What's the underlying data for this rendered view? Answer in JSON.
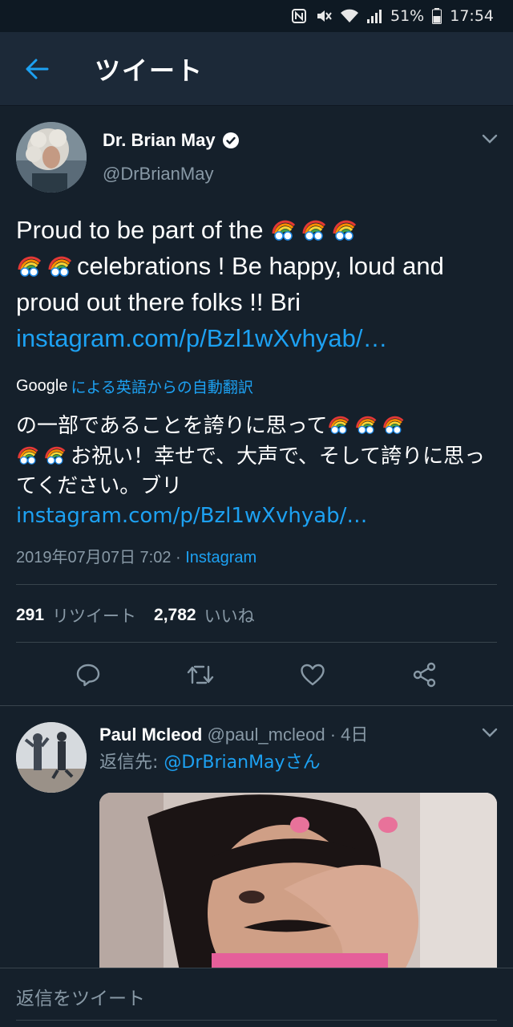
{
  "status_bar": {
    "battery": "51%",
    "time": "17:54",
    "icons": [
      "nfc-icon",
      "mute-icon",
      "wifi-icon",
      "signal-icon",
      "battery-icon"
    ]
  },
  "header": {
    "back_icon": "arrow-left-icon",
    "title": "ツイート"
  },
  "tweet": {
    "author_name": "Dr. Brian May",
    "verified_icon": "verified-badge-icon",
    "handle": "@DrBrianMay",
    "text_part1": "Proud to be part of the ",
    "text_part2": "celebrations ! Be happy, loud and proud out there folks !! Bri ",
    "text_link": "instagram.com/p/Bzl1wXvhyab/…",
    "translation_brand": "Google",
    "translation_label": "による英語からの自動翻訳",
    "translated_part1": "の一部であることを誇りに思って",
    "translated_part2": "お祝い！幸せで、大声で、そして誇りに思ってください。ブリ",
    "translated_link": "instagram.com/p/Bzl1wXvhyab/…",
    "timestamp": "2019年07月07日 7:02 · ",
    "source": "Instagram",
    "retweet_count": "291",
    "retweet_label": "リツイート",
    "like_count": "2,782",
    "like_label": "いいね",
    "actions": [
      "reply-icon",
      "retweet-icon",
      "like-icon",
      "share-icon"
    ]
  },
  "reply": {
    "name": "Paul Mcleod",
    "handle": "@paul_mcleod",
    "time": " · 4日",
    "reply_to_prefix": "返信先: ",
    "reply_to_handle": "@DrBrianMay",
    "reply_to_suffix": "さん"
  },
  "compose": {
    "placeholder": "返信をツイート"
  },
  "colors": {
    "background": "#15202b",
    "header": "#1c2938",
    "accent": "#1da1f2",
    "secondary_text": "#8899a6",
    "divider": "#38444d"
  }
}
